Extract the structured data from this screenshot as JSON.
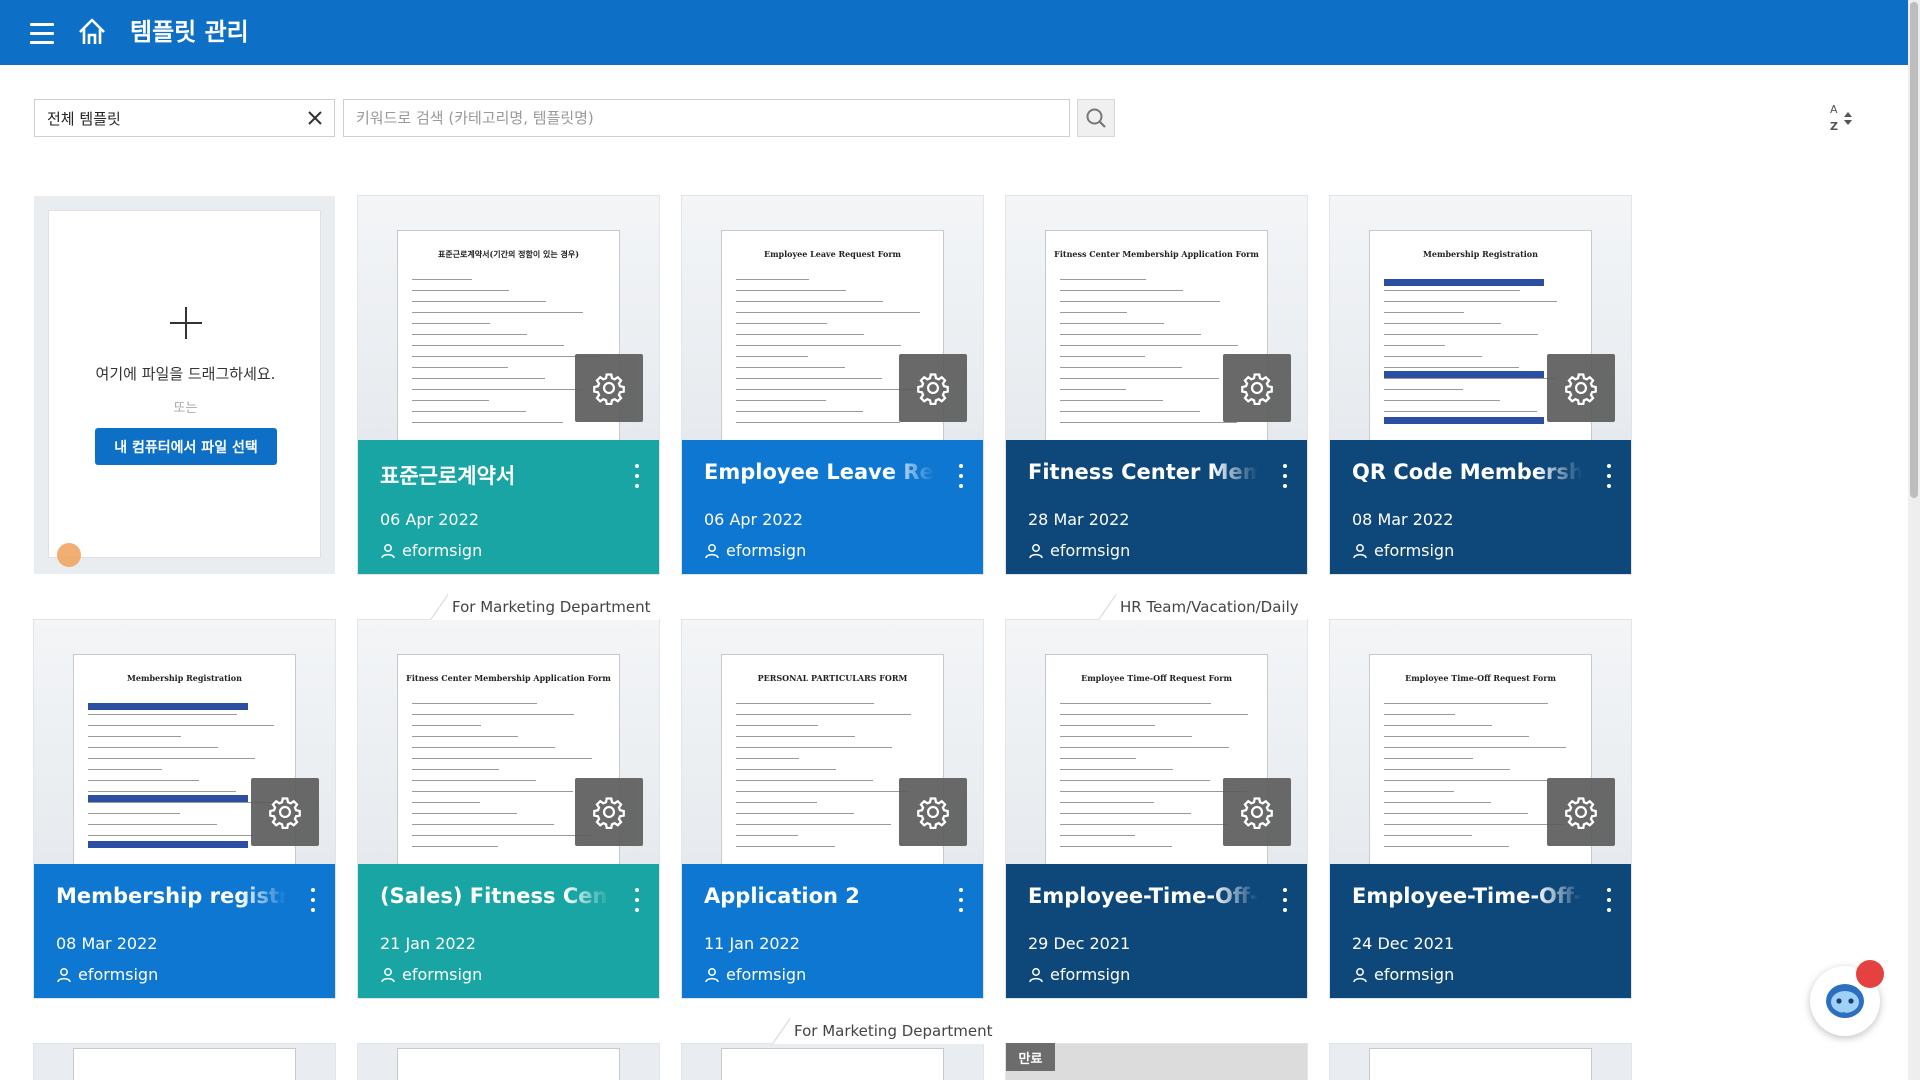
{
  "header": {
    "title": "템플릿 관리"
  },
  "search": {
    "category_value": "전체 템플릿",
    "placeholder": "키워드로 검색 (카테고리명, 템플릿명)"
  },
  "upload": {
    "drag_text": "여기에 파일을 드래그하세요.",
    "or_text": "또는",
    "button_label": "내 컴퓨터에서 파일 선택"
  },
  "cards": [
    {
      "title": "표준근로계약서",
      "date": "06 Apr 2022",
      "owner": "eformsign",
      "color": "#18a5a3",
      "doc_title": "표준근로계약서(기간의 정함이 있는 경우)"
    },
    {
      "title": "Employee Leave Request Form",
      "date": "06 Apr 2022",
      "owner": "eformsign",
      "color": "#0d77d1",
      "doc_title": "Employee Leave Request Form"
    },
    {
      "title": "Fitness Center Membership Application Form",
      "date": "28 Mar 2022",
      "owner": "eformsign",
      "color": "#0e4779",
      "doc_title": "Fitness Center Membership Application Form"
    },
    {
      "title": "QR Code Membership Registration",
      "date": "08 Mar 2022",
      "owner": "eformsign",
      "color": "#0e4779",
      "doc_title": "Membership Registration"
    },
    {
      "title": "Membership registration",
      "date": "08 Mar 2022",
      "owner": "eformsign",
      "color": "#0d77d1",
      "doc_title": "Membership Registration"
    },
    {
      "title": "(Sales) Fitness Center Membership",
      "date": "21 Jan 2022",
      "owner": "eformsign",
      "color": "#18a5a3",
      "doc_title": "Fitness Center Membership Application Form",
      "tag": "For Marketing Department"
    },
    {
      "title": "Application 2",
      "date": "11 Jan 2022",
      "owner": "eformsign",
      "color": "#0d77d1",
      "doc_title": "PERSONAL PARTICULARS FORM"
    },
    {
      "title": "Employee-Time-Off-Request",
      "date": "29 Dec 2021",
      "owner": "eformsign",
      "color": "#0e4779",
      "doc_title": "Employee Time-Off Request Form",
      "tag": "HR Team/Vacation/Daily"
    },
    {
      "title": "Employee-Time-Off-Request",
      "date": "24 Dec 2021",
      "owner": "eformsign",
      "color": "#0e4779",
      "doc_title": "Employee Time-Off Request Form"
    }
  ],
  "bottom_row": {
    "tag": "For Marketing Department",
    "expired_badge": "만료"
  },
  "colors": {
    "header": "#0d6fc6",
    "teal": "#18a5a3",
    "blue": "#0d77d1",
    "navy": "#0e4779"
  }
}
